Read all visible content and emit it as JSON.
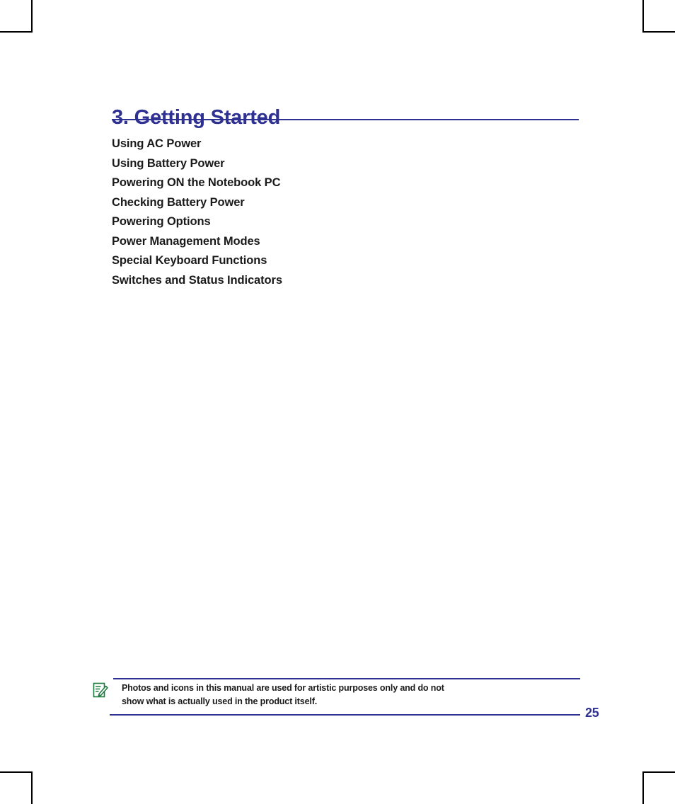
{
  "document": {
    "chapter_heading": "3. Getting Started",
    "contents": [
      "Using AC Power",
      "Using Battery Power",
      "Powering ON the Notebook PC",
      "Checking Battery Power",
      "Powering Options",
      "Power Management Modes",
      "Special Keyboard Functions",
      "Switches and Status Indicators"
    ],
    "note": {
      "icon": "note-pencil-icon",
      "line1": "Photos and icons in this manual are used for artistic purposes only and do not",
      "line2": "show what is actually used in the product itself."
    },
    "page_number": "25",
    "colors": {
      "heading": "#2e3192",
      "rule": "#2e3192",
      "body_text": "#1a1a1a",
      "note_icon": "#1c7a3e",
      "crop_mark": "#000000"
    }
  }
}
